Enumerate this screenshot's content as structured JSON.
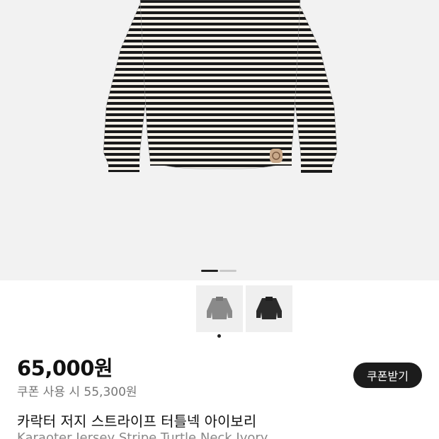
{
  "gallery": {
    "image_alt": "striped knit sweatshirt",
    "slide_indicator": {
      "current": 1,
      "total": 2
    },
    "thumbnails": [
      {
        "name": "gray-variant",
        "color": "#8a8a8a"
      },
      {
        "name": "black-variant",
        "color": "#2b2b2b"
      }
    ]
  },
  "product": {
    "price": "65,000원",
    "coupon_price": "쿠폰 사용 시 55,300원",
    "coupon_button": "쿠폰받기",
    "title_ko": "카락터 저지 스트라이프 터틀넥 아이보리",
    "title_en": "Karaoter Jersey Stripe Turtle Neck Ivory"
  },
  "colors": {
    "background_hero": "#f2f2f2",
    "stripe_dark": "#1a1a1a",
    "stripe_light": "#f5f1e8",
    "button": "#1c1c1c"
  }
}
